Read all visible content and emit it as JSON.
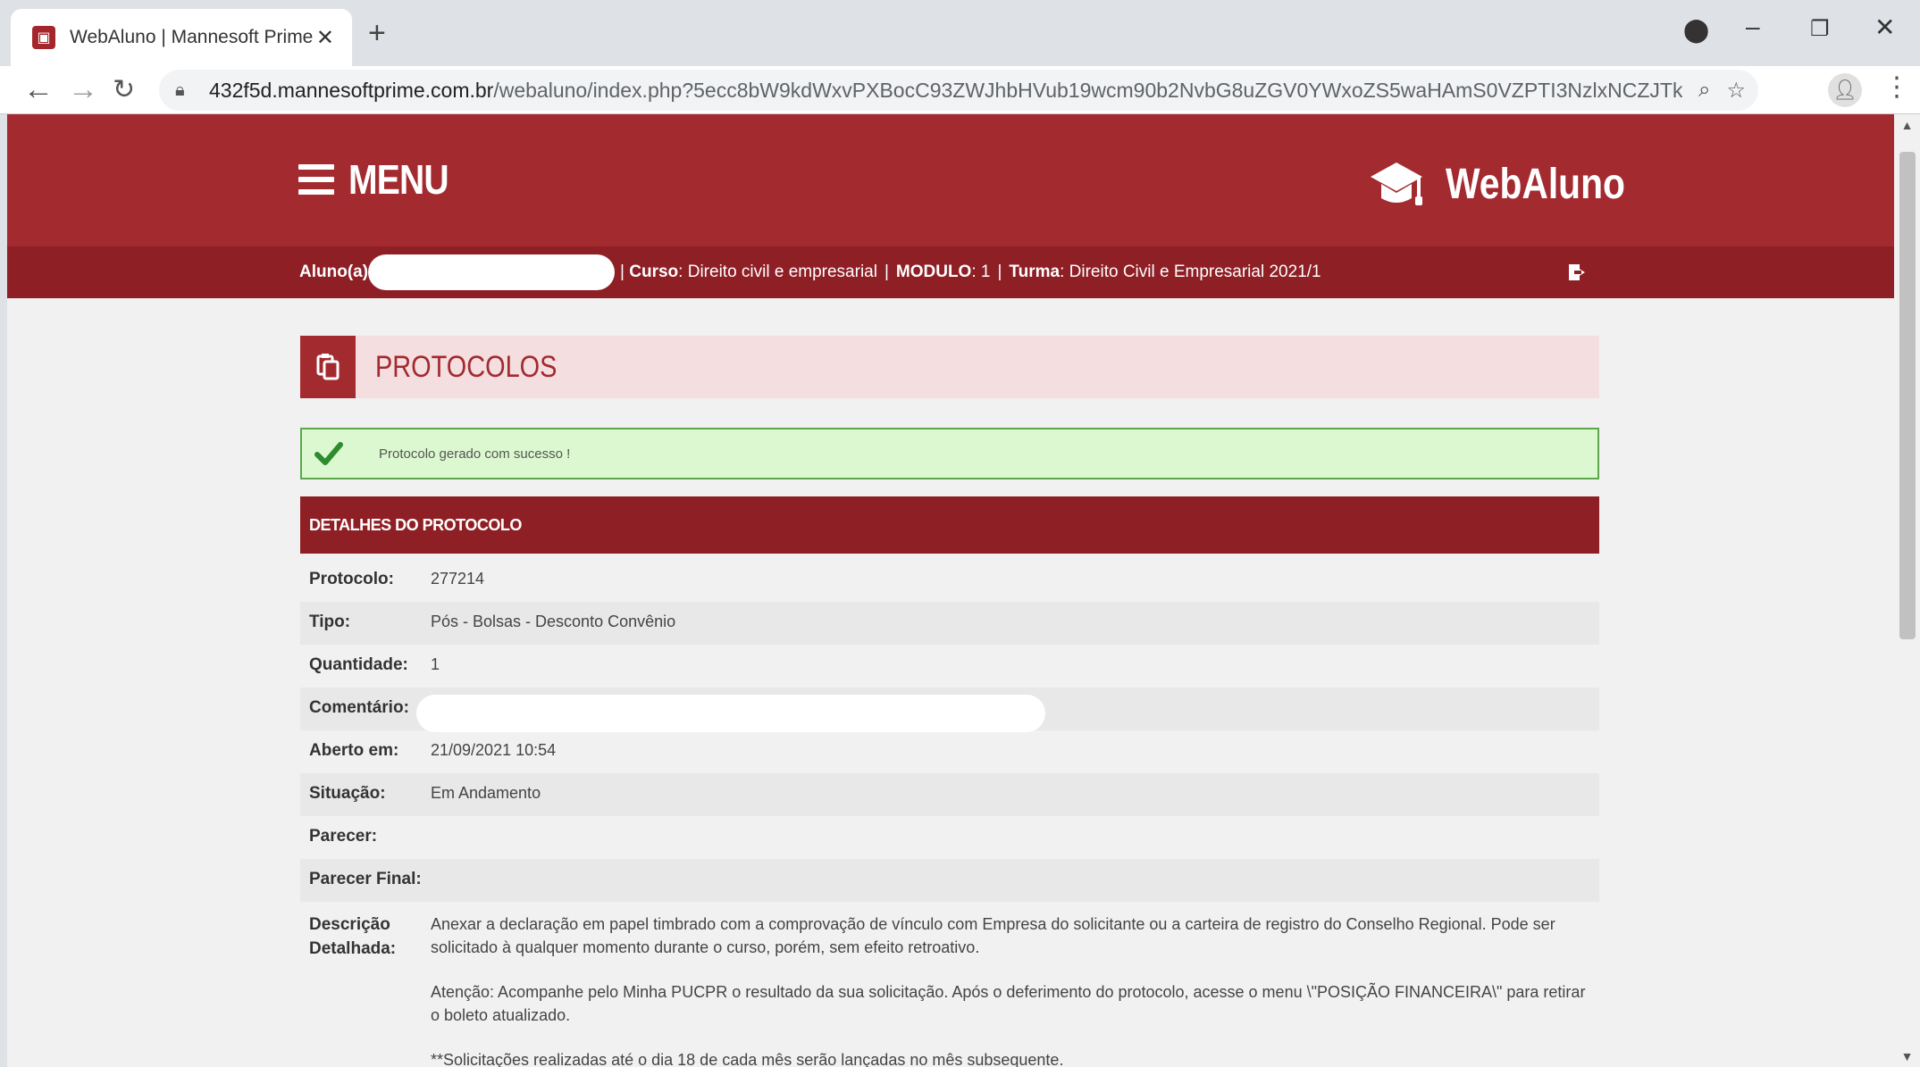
{
  "browser": {
    "tab_title": "WebAluno | Mannesoft Prime",
    "url_domain": "432f5d.mannesoftprime.com.br",
    "url_path": "/webaluno/index.php?5ecc8bW9kdWxvPXBocC93ZWJhbHVub19wcm90b2NvbG8uZGV0YWxoZS5waHAmS0VZPTI3NzlxNCZJTkNMVUlSX0NBR..."
  },
  "header": {
    "menu_label": "MENU",
    "brand_name": "WebAluno"
  },
  "infobar": {
    "aluno_label": "Aluno(a)",
    "curso_label": "Curso",
    "curso_value": ": Direito civil e empresarial",
    "modulo_label": "MODULO",
    "modulo_value": ": 1",
    "turma_label": "Turma",
    "turma_value": ": Direito Civil e Empresarial 2021/1"
  },
  "page": {
    "title": "PROTOCOLOS",
    "alert_text": "Protocolo gerado com sucesso !",
    "details_header": "DETALHES DO PROTOCOLO"
  },
  "details": {
    "protocolo_label": "Protocolo:",
    "protocolo_value": "277214",
    "tipo_label": "Tipo:",
    "tipo_value": "Pós - Bolsas - Desconto Convênio",
    "quantidade_label": "Quantidade:",
    "quantidade_value": "1",
    "comentario_label": "Comentário:",
    "aberto_label": "Aberto em:",
    "aberto_value": "21/09/2021 10:54",
    "situacao_label": "Situação:",
    "situacao_value": "Em Andamento",
    "parecer_label": "Parecer:",
    "parecer_final_label": "Parecer Final:",
    "descricao_label_1": "Descrição",
    "descricao_label_2": "Detalhada:",
    "descricao_p1": "Anexar a declaração em papel timbrado com a comprovação de vínculo com Empresa do solicitante ou a carteira de registro do Conselho Regional. Pode ser solicitado à qualquer momento durante o curso, porém, sem efeito retroativo.",
    "descricao_p2": "Atenção: Acompanhe pelo Minha PUCPR o resultado da sua solicitação. Após o deferimento do protocolo, acesse o menu \\\"POSIÇÃO FINANCEIRA\\\" para retirar o boleto atualizado.",
    "descricao_p3": "**Solicitações realizadas até o dia 18 de cada mês serão lançadas no mês subsequente."
  },
  "colors": {
    "brand_red": "#a32a2f",
    "infobar_red": "#8e1f25",
    "success_green": "#2e8b2e"
  }
}
